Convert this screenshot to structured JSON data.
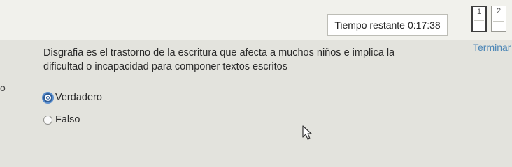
{
  "header": {
    "timer_label": "Tiempo restante",
    "timer_value": "0:17:38",
    "question_nav": [
      {
        "number": "1",
        "current": true
      },
      {
        "number": "2",
        "current": false
      }
    ],
    "finish_link": "Terminar i"
  },
  "left_crop_text": "o",
  "question": {
    "text": "Disgrafia es el trastorno de la escritura que afecta a muchos niños e implica la dificultad o incapacidad para componer textos escritos",
    "options": [
      {
        "label": "Verdadero",
        "focused": true
      },
      {
        "label": "Falso",
        "focused": false
      }
    ]
  },
  "colors": {
    "link": "#4c86b6",
    "focus_ring": "#5b8fcf",
    "background": "#e3e3dd"
  }
}
